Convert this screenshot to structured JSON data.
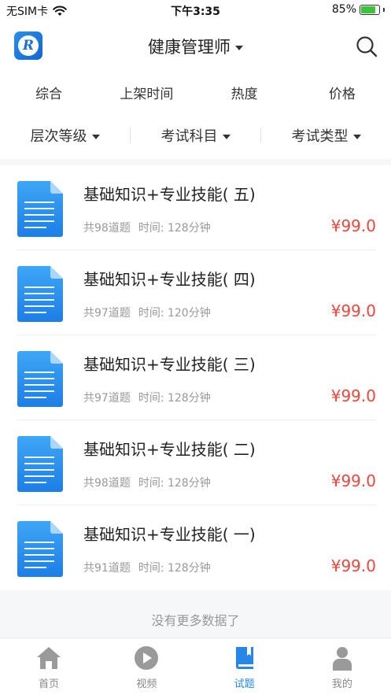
{
  "status_bar": {
    "carrier": "无SIM卡",
    "time": "下午3:35",
    "battery": "85%",
    "battery_level": 0.85
  },
  "nav": {
    "logo_letter": "R",
    "title": "健康管理师"
  },
  "sort_tabs": [
    "综合",
    "上架时间",
    "热度",
    "价格"
  ],
  "filters": [
    "层次等级",
    "考试科目",
    "考试类型"
  ],
  "items": [
    {
      "title": "基础知识+专业技能( 五)",
      "count": "共98道题",
      "time": "时间: 128分钟",
      "price": "¥99.0"
    },
    {
      "title": "基础知识+专业技能( 四)",
      "count": "共97道题",
      "time": "时间: 120分钟",
      "price": "¥99.0"
    },
    {
      "title": "基础知识+专业技能( 三)",
      "count": "共97道题",
      "time": "时间: 128分钟",
      "price": "¥99.0"
    },
    {
      "title": "基础知识+专业技能( 二)",
      "count": "共98道题",
      "time": "时间: 128分钟",
      "price": "¥99.0"
    },
    {
      "title": "基础知识+专业技能( 一)",
      "count": "共91道题",
      "time": "时间: 128分钟",
      "price": "¥99.0"
    }
  ],
  "no_more_text": "没有更多数据了",
  "tab_bar": [
    {
      "label": "首页",
      "icon": "home-icon"
    },
    {
      "label": "视频",
      "icon": "video-icon"
    },
    {
      "label": "试题",
      "icon": "book-icon",
      "active": true
    },
    {
      "label": "我的",
      "icon": "user-icon"
    }
  ],
  "colors": {
    "accent": "#2787e8",
    "price": "#f0453b",
    "muted": "#999999",
    "battery_green": "#3ac43a"
  }
}
